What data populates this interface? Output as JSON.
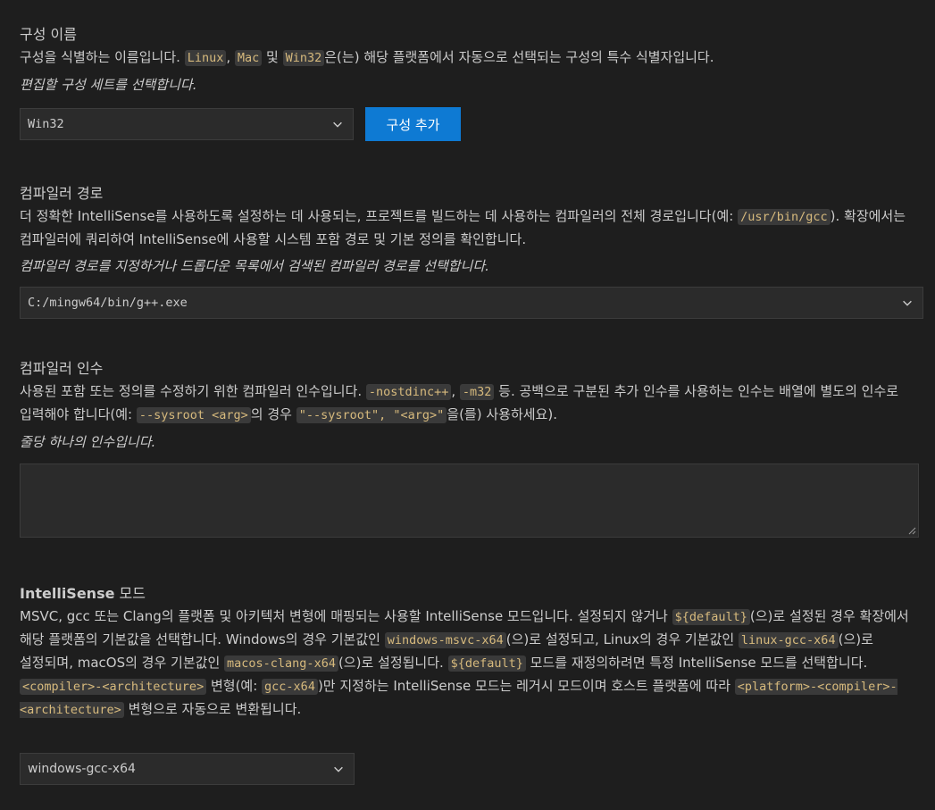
{
  "config_name": {
    "title": "구성 이름",
    "desc_parts": [
      "구성을 식별하는 이름입니다. ",
      "Linux",
      ", ",
      "Mac",
      " 및 ",
      "Win32",
      "은(는) 해당 플랫폼에서 자동으로 선택되는 구성의 특수 식별자입니다."
    ],
    "hint": "편집할 구성 세트를 선택합니다.",
    "selected": "Win32",
    "add_button": "구성 추가"
  },
  "compiler_path": {
    "title": "컴파일러 경로",
    "desc_line1": "더 정확한 IntelliSense를 사용하도록 설정하는 데 사용되는, 프로젝트를 빌드하는 데 사용하는 컴파일러의 전체 경로입니다(예:",
    "desc_code": "/usr/bin/gcc",
    "desc_line2": "). 확장에서는 컴파일러에 쿼리하여 IntelliSense에 사용할 시스템 포함 경로 및 기본 정의를 확인합니다.",
    "hint": "컴파일러 경로를 지정하거나 드롭다운 목록에서 검색된 컴파일러 경로를 선택합니다.",
    "selected": "C:/mingw64/bin/g++.exe"
  },
  "compiler_args": {
    "title": "컴파일러 인수",
    "t1": "사용된 포함 또는 정의를 수정하기 위한 컴파일러 인수입니다. ",
    "c1": "-nostdinc++",
    "t2": ", ",
    "c2": "-m32",
    "t3": " 등. 공백으로 구분된 추가 인수를 사용하는 인수는 배열에 별도의 인수로 입력해야 합니다(예: ",
    "c3": "--sysroot <arg>",
    "t4": "의 경우 ",
    "c4": "\"--sysroot\", \"<arg>\"",
    "t5": "을(를) 사용하세요).",
    "hint": "줄당 하나의 인수입니다.",
    "value": ""
  },
  "intellisense_mode": {
    "title_bold": "IntelliSense",
    "title_rest": " 모드",
    "t1": "MSVC, gcc 또는 Clang의 플랫폼 및 아키텍처 변형에 매핑되는 사용할 IntelliSense 모드입니다. 설정되지 않거나 ",
    "c1": "${default}",
    "t2": "(으)로 설정된 경우 확장에서 해당 플랫폼의 기본값을 선택합니다. Windows의 경우 기본값인 ",
    "c2": "windows-msvc-x64",
    "t3": "(으)로 설정되고, Linux의 경우 기본값인 ",
    "c3": "linux-gcc-x64",
    "t4": "(으)로 설정되며, macOS의 경우 기본값인 ",
    "c4": "macos-clang-x64",
    "t5": "(으)로 설정됩니다. ",
    "c5": "${default}",
    "t6": " 모드를 재정의하려면 특정 IntelliSense 모드를 선택합니다. ",
    "c6": "<compiler>-<architecture>",
    "t7": " 변형(예: ",
    "c7": "gcc-x64",
    "t8": ")만 지정하는 IntelliSense 모드는 레거시 모드이며 호스트 플랫폼에 따라 ",
    "c8": "<platform>-<compiler>-<architecture>",
    "t9": " 변형으로 자동으로 변환됩니다.",
    "selected": "windows-gcc-x64"
  },
  "icons": {
    "dropdown": "chevron-down-icon",
    "resize": "resize-grip-icon"
  },
  "colors": {
    "accent": "#0e7ad3",
    "code_text": "#d7ba7d",
    "background": "#1e1e1e"
  }
}
